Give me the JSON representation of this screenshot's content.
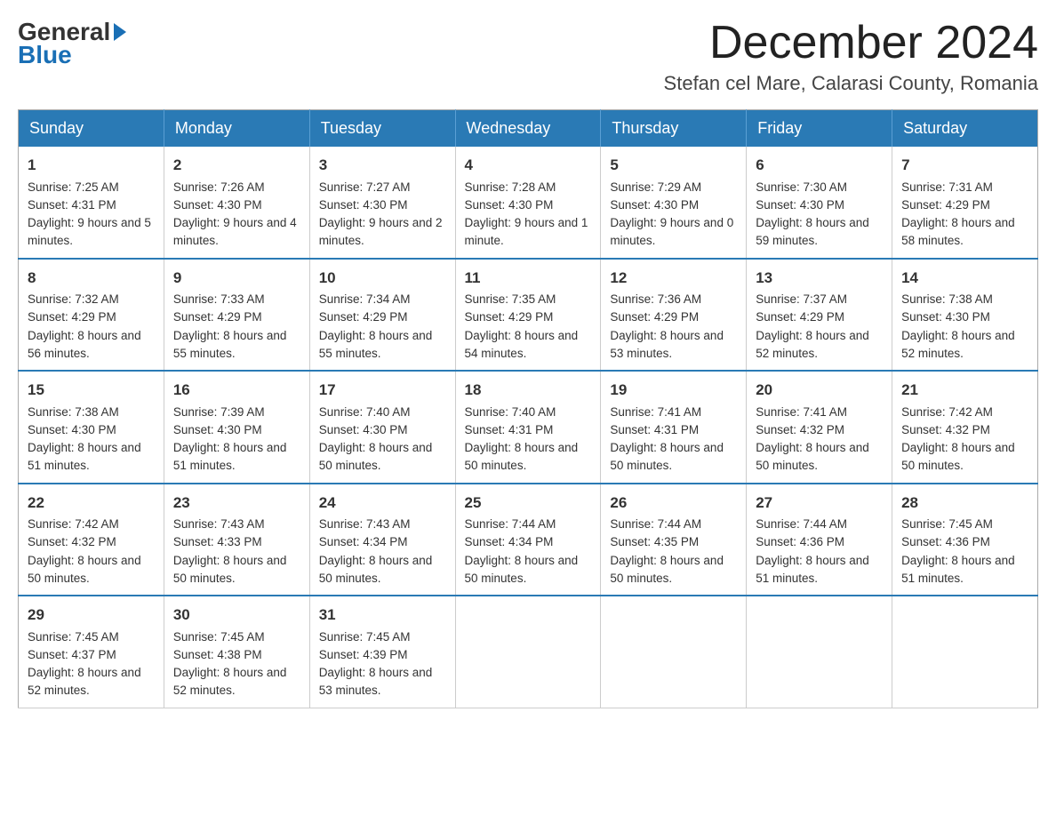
{
  "logo": {
    "general": "General",
    "blue": "Blue"
  },
  "title": "December 2024",
  "subtitle": "Stefan cel Mare, Calarasi County, Romania",
  "header_days": [
    "Sunday",
    "Monday",
    "Tuesday",
    "Wednesday",
    "Thursday",
    "Friday",
    "Saturday"
  ],
  "weeks": [
    [
      {
        "day": "1",
        "sunrise": "7:25 AM",
        "sunset": "4:31 PM",
        "daylight": "9 hours and 5 minutes."
      },
      {
        "day": "2",
        "sunrise": "7:26 AM",
        "sunset": "4:30 PM",
        "daylight": "9 hours and 4 minutes."
      },
      {
        "day": "3",
        "sunrise": "7:27 AM",
        "sunset": "4:30 PM",
        "daylight": "9 hours and 2 minutes."
      },
      {
        "day": "4",
        "sunrise": "7:28 AM",
        "sunset": "4:30 PM",
        "daylight": "9 hours and 1 minute."
      },
      {
        "day": "5",
        "sunrise": "7:29 AM",
        "sunset": "4:30 PM",
        "daylight": "9 hours and 0 minutes."
      },
      {
        "day": "6",
        "sunrise": "7:30 AM",
        "sunset": "4:30 PM",
        "daylight": "8 hours and 59 minutes."
      },
      {
        "day": "7",
        "sunrise": "7:31 AM",
        "sunset": "4:29 PM",
        "daylight": "8 hours and 58 minutes."
      }
    ],
    [
      {
        "day": "8",
        "sunrise": "7:32 AM",
        "sunset": "4:29 PM",
        "daylight": "8 hours and 56 minutes."
      },
      {
        "day": "9",
        "sunrise": "7:33 AM",
        "sunset": "4:29 PM",
        "daylight": "8 hours and 55 minutes."
      },
      {
        "day": "10",
        "sunrise": "7:34 AM",
        "sunset": "4:29 PM",
        "daylight": "8 hours and 55 minutes."
      },
      {
        "day": "11",
        "sunrise": "7:35 AM",
        "sunset": "4:29 PM",
        "daylight": "8 hours and 54 minutes."
      },
      {
        "day": "12",
        "sunrise": "7:36 AM",
        "sunset": "4:29 PM",
        "daylight": "8 hours and 53 minutes."
      },
      {
        "day": "13",
        "sunrise": "7:37 AM",
        "sunset": "4:29 PM",
        "daylight": "8 hours and 52 minutes."
      },
      {
        "day": "14",
        "sunrise": "7:38 AM",
        "sunset": "4:30 PM",
        "daylight": "8 hours and 52 minutes."
      }
    ],
    [
      {
        "day": "15",
        "sunrise": "7:38 AM",
        "sunset": "4:30 PM",
        "daylight": "8 hours and 51 minutes."
      },
      {
        "day": "16",
        "sunrise": "7:39 AM",
        "sunset": "4:30 PM",
        "daylight": "8 hours and 51 minutes."
      },
      {
        "day": "17",
        "sunrise": "7:40 AM",
        "sunset": "4:30 PM",
        "daylight": "8 hours and 50 minutes."
      },
      {
        "day": "18",
        "sunrise": "7:40 AM",
        "sunset": "4:31 PM",
        "daylight": "8 hours and 50 minutes."
      },
      {
        "day": "19",
        "sunrise": "7:41 AM",
        "sunset": "4:31 PM",
        "daylight": "8 hours and 50 minutes."
      },
      {
        "day": "20",
        "sunrise": "7:41 AM",
        "sunset": "4:32 PM",
        "daylight": "8 hours and 50 minutes."
      },
      {
        "day": "21",
        "sunrise": "7:42 AM",
        "sunset": "4:32 PM",
        "daylight": "8 hours and 50 minutes."
      }
    ],
    [
      {
        "day": "22",
        "sunrise": "7:42 AM",
        "sunset": "4:32 PM",
        "daylight": "8 hours and 50 minutes."
      },
      {
        "day": "23",
        "sunrise": "7:43 AM",
        "sunset": "4:33 PM",
        "daylight": "8 hours and 50 minutes."
      },
      {
        "day": "24",
        "sunrise": "7:43 AM",
        "sunset": "4:34 PM",
        "daylight": "8 hours and 50 minutes."
      },
      {
        "day": "25",
        "sunrise": "7:44 AM",
        "sunset": "4:34 PM",
        "daylight": "8 hours and 50 minutes."
      },
      {
        "day": "26",
        "sunrise": "7:44 AM",
        "sunset": "4:35 PM",
        "daylight": "8 hours and 50 minutes."
      },
      {
        "day": "27",
        "sunrise": "7:44 AM",
        "sunset": "4:36 PM",
        "daylight": "8 hours and 51 minutes."
      },
      {
        "day": "28",
        "sunrise": "7:45 AM",
        "sunset": "4:36 PM",
        "daylight": "8 hours and 51 minutes."
      }
    ],
    [
      {
        "day": "29",
        "sunrise": "7:45 AM",
        "sunset": "4:37 PM",
        "daylight": "8 hours and 52 minutes."
      },
      {
        "day": "30",
        "sunrise": "7:45 AM",
        "sunset": "4:38 PM",
        "daylight": "8 hours and 52 minutes."
      },
      {
        "day": "31",
        "sunrise": "7:45 AM",
        "sunset": "4:39 PM",
        "daylight": "8 hours and 53 minutes."
      },
      null,
      null,
      null,
      null
    ]
  ]
}
